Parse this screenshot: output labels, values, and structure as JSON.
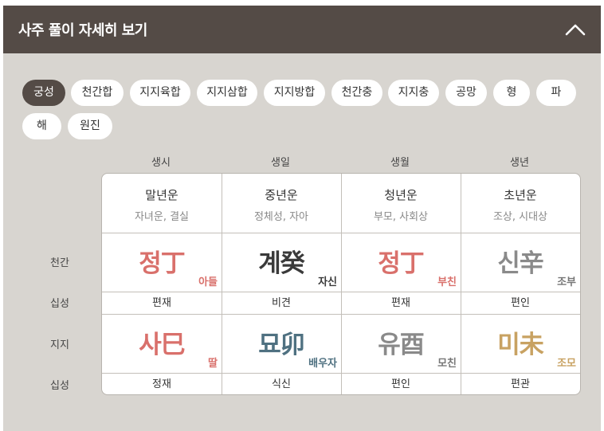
{
  "header": {
    "title": "사주 풀이 자세히 보기",
    "collapse_icon": "chevron-up-icon"
  },
  "chips": [
    {
      "label": "궁성",
      "active": true
    },
    {
      "label": "천간합",
      "active": false
    },
    {
      "label": "지지육합",
      "active": false
    },
    {
      "label": "지지삼합",
      "active": false
    },
    {
      "label": "지지방합",
      "active": false
    },
    {
      "label": "천간충",
      "active": false
    },
    {
      "label": "지지충",
      "active": false
    },
    {
      "label": "공망",
      "active": false
    },
    {
      "label": "형",
      "active": false
    },
    {
      "label": "파",
      "active": false
    },
    {
      "label": "해",
      "active": false
    },
    {
      "label": "원진",
      "active": false
    }
  ],
  "columns": [
    "생시",
    "생일",
    "생월",
    "생년"
  ],
  "row_labels": {
    "cheongan": "천간",
    "sipseong1": "십성",
    "jiji": "지지",
    "sipseong2": "십성"
  },
  "periods": [
    {
      "main": "말년운",
      "sub": "자녀운, 결실"
    },
    {
      "main": "중년운",
      "sub": "정체성, 자아"
    },
    {
      "main": "청년운",
      "sub": "부모, 사회상"
    },
    {
      "main": "초년운",
      "sub": "조상, 시대상"
    }
  ],
  "cheongan": [
    {
      "char": "정丁",
      "rel": "아들",
      "color": "#d9706b",
      "rel_color": "#d9706b"
    },
    {
      "char": "계癸",
      "rel": "자신",
      "color": "#3a3a3a",
      "rel_color": "#3a3a3a"
    },
    {
      "char": "정丁",
      "rel": "부친",
      "color": "#d9706b",
      "rel_color": "#d9706b"
    },
    {
      "char": "신辛",
      "rel": "조부",
      "color": "#8a8a8a",
      "rel_color": "#777777"
    }
  ],
  "sipseong_top": [
    "편재",
    "비견",
    "편재",
    "편인"
  ],
  "jiji": [
    {
      "char": "사巳",
      "rel": "딸",
      "color": "#d9706b",
      "rel_color": "#d9706b"
    },
    {
      "char": "묘卯",
      "rel": "배우자",
      "color": "#4f7181",
      "rel_color": "#4f7181"
    },
    {
      "char": "유酉",
      "rel": "모친",
      "color": "#8a8a8a",
      "rel_color": "#777777"
    },
    {
      "char": "미未",
      "rel": "조모",
      "color": "#c8a262",
      "rel_color": "#c8a262"
    }
  ],
  "sipseong_bottom": [
    "정재",
    "식신",
    "편인",
    "편관"
  ]
}
